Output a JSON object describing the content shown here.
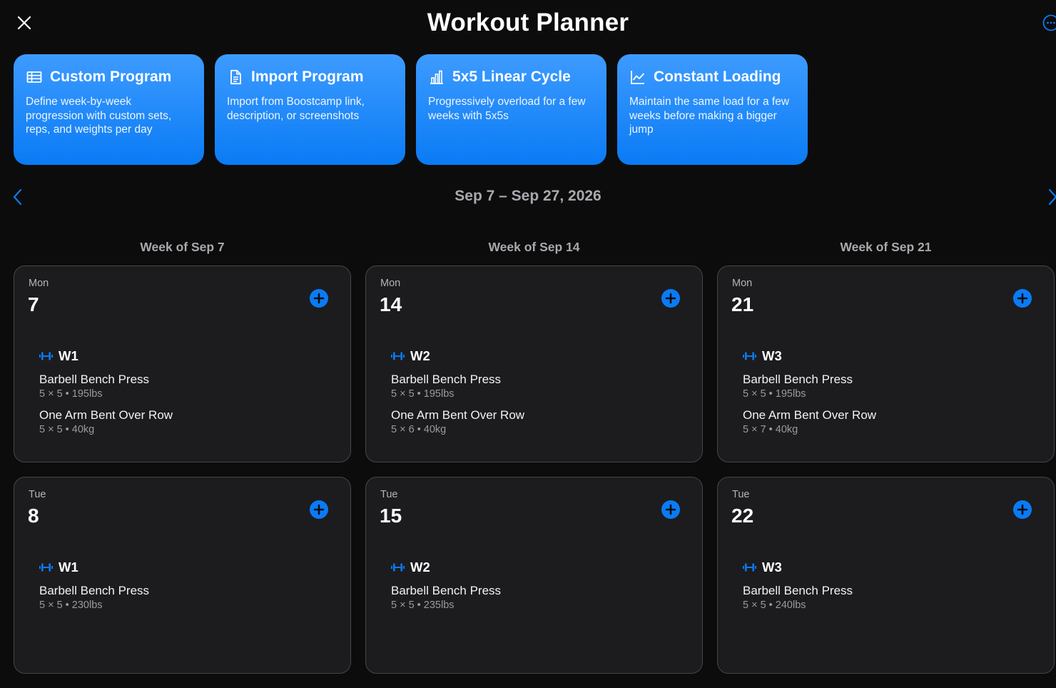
{
  "header": {
    "title": "Workout Planner"
  },
  "program_cards": [
    {
      "icon": "table-icon",
      "title": "Custom Program",
      "description": "Define week-by-week progression with custom sets, reps, and weights per day"
    },
    {
      "icon": "document-icon",
      "title": "Import Program",
      "description": "Import from Boostcamp link, description, or screenshots"
    },
    {
      "icon": "bar-chart-icon",
      "title": "5x5 Linear Cycle",
      "description": "Progressively overload for a few weeks with 5x5s"
    },
    {
      "icon": "line-chart-icon",
      "title": "Constant Loading",
      "description": "Maintain the same load for a few weeks before making a bigger jump"
    }
  ],
  "date_range": "Sep 7 – Sep 27, 2026",
  "accent_color": "#0a7bf5",
  "weeks": [
    {
      "title": "Week of Sep 7",
      "days": [
        {
          "dow": "Mon",
          "day": "7",
          "workout": "W1",
          "exercises": [
            {
              "name": "Barbell Bench Press",
              "detail": "5 × 5 • 195lbs"
            },
            {
              "name": "One Arm Bent Over Row",
              "detail": "5 × 5 • 40kg"
            }
          ]
        },
        {
          "dow": "Tue",
          "day": "8",
          "workout": "W1",
          "exercises": [
            {
              "name": "Barbell Bench Press",
              "detail": "5 × 5 • 230lbs"
            }
          ]
        }
      ]
    },
    {
      "title": "Week of Sep 14",
      "days": [
        {
          "dow": "Mon",
          "day": "14",
          "workout": "W2",
          "exercises": [
            {
              "name": "Barbell Bench Press",
              "detail": "5 × 5 • 195lbs"
            },
            {
              "name": "One Arm Bent Over Row",
              "detail": "5 × 6 • 40kg"
            }
          ]
        },
        {
          "dow": "Tue",
          "day": "15",
          "workout": "W2",
          "exercises": [
            {
              "name": "Barbell Bench Press",
              "detail": "5 × 5 • 235lbs"
            }
          ]
        }
      ]
    },
    {
      "title": "Week of Sep 21",
      "days": [
        {
          "dow": "Mon",
          "day": "21",
          "workout": "W3",
          "exercises": [
            {
              "name": "Barbell Bench Press",
              "detail": "5 × 5 • 195lbs"
            },
            {
              "name": "One Arm Bent Over Row",
              "detail": "5 × 7 • 40kg"
            }
          ]
        },
        {
          "dow": "Tue",
          "day": "22",
          "workout": "W3",
          "exercises": [
            {
              "name": "Barbell Bench Press",
              "detail": "5 × 5 • 240lbs"
            }
          ]
        }
      ]
    }
  ]
}
